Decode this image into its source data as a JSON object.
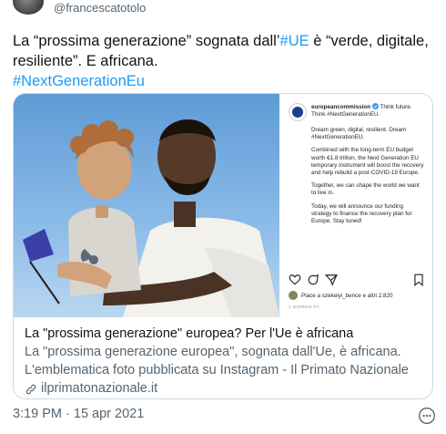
{
  "user": {
    "handle": "@francescatotolo"
  },
  "tweet": {
    "line1_prefix": "La “prossima generazione” sognata dall’",
    "line1_hashtag": "#UE",
    "line1_suffix": " è “verde, digitale,",
    "line2": "resiliente”. E africana.",
    "line3_hashtag": "#NextGenerationEu"
  },
  "instagram": {
    "account": "europeancommission",
    "intro_text": "Think future. Think #NextGenerationEU.",
    "caption": [
      "Dream green, digital, resilient. Dream #NextGenerationEU.",
      "Combined with the long-term EU budget worth €1.8 trillion, the Next Generation EU temporary instrument will boost the recovery and help rebuild a post-COVID-19 Europe.",
      "Together, we can shape the world we want to live in.",
      "Today, we will announce our funding strategy to finance the recovery plan for Europe. Stay tuned!"
    ],
    "likes_text": "Piace a szekelyi_bence e altri 2.820",
    "date_text": "1 GIORNO FA"
  },
  "card": {
    "title": "La \"prossima generazione\" europea? Per l'Ue è africana",
    "description_line1": "La \"prossima generazione europea\", sognata dall'Ue, è africana.",
    "description_line2": "L'emblematica foto pubblicata su Instagram - Il Primato Nazionale",
    "domain": "ilprimatonazionale.it"
  },
  "meta": {
    "timestamp": "3:19 PM · 15 apr 2021"
  },
  "colors": {
    "link": "#1d9bf0",
    "secondary_text": "#536471",
    "border": "#cfd9de"
  },
  "icons": {
    "verified": "verified-badge-icon",
    "heart": "heart-icon",
    "comment": "comment-icon",
    "share": "share-icon",
    "bookmark": "bookmark-icon",
    "link": "link-icon",
    "more": "more-icon"
  }
}
